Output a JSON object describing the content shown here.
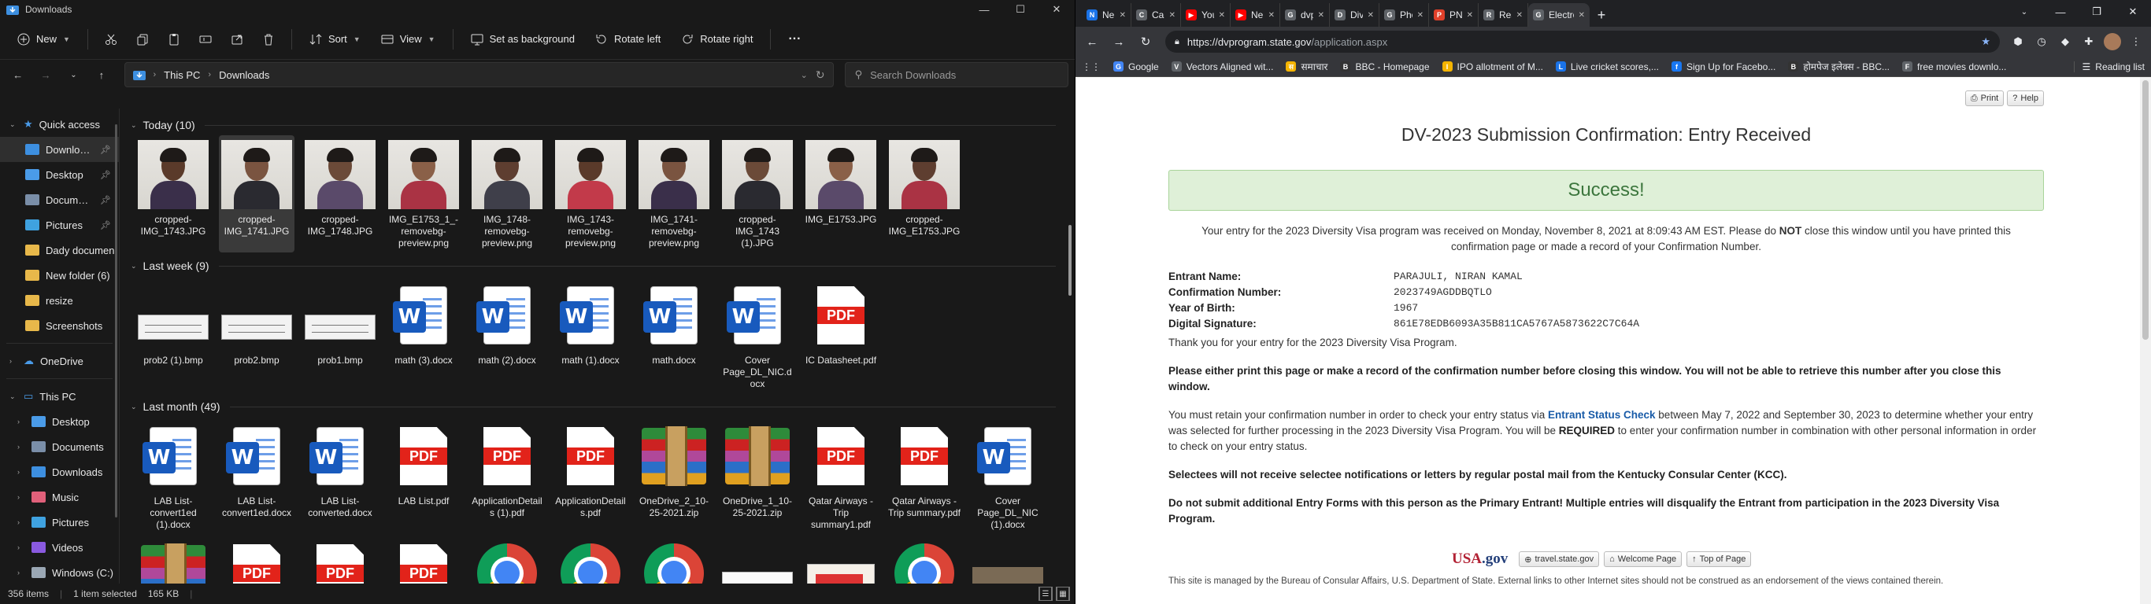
{
  "explorer": {
    "title": "Downloads",
    "window_controls": [
      "—",
      "☐",
      "✕"
    ],
    "commands": {
      "new": "New",
      "sort": "Sort",
      "view": "View",
      "set_background": "Set as background",
      "rotate_left": "Rotate left",
      "rotate_right": "Rotate right",
      "more": "···"
    },
    "breadcrumb": [
      "This PC",
      "Downloads"
    ],
    "search_placeholder": "Search Downloads",
    "nav": {
      "quick_access": "Quick access",
      "quick_items": [
        {
          "label": "Downloads",
          "pinned": true,
          "color": "#3d8fe0"
        },
        {
          "label": "Desktop",
          "pinned": true,
          "color": "#4a9be8"
        },
        {
          "label": "Documents",
          "pinned": true,
          "color": "#7a8ea8"
        },
        {
          "label": "Pictures",
          "pinned": true,
          "color": "#3fa2e0"
        },
        {
          "label": "Dady documen",
          "pinned": false,
          "color": "#e8b84a"
        },
        {
          "label": "New folder (6)",
          "pinned": false,
          "color": "#e8b84a"
        },
        {
          "label": "resize",
          "pinned": false,
          "color": "#e8b84a"
        },
        {
          "label": "Screenshots",
          "pinned": false,
          "color": "#e8b84a"
        }
      ],
      "onedrive": "OneDrive",
      "this_pc": "This PC",
      "pc_items": [
        {
          "label": "Desktop",
          "color": "#4a9be8"
        },
        {
          "label": "Documents",
          "color": "#7a8ea8"
        },
        {
          "label": "Downloads",
          "color": "#3d8fe0"
        },
        {
          "label": "Music",
          "color": "#e0607a"
        },
        {
          "label": "Pictures",
          "color": "#3fa2e0"
        },
        {
          "label": "Videos",
          "color": "#8a5ae0"
        },
        {
          "label": "Windows (C:)",
          "color": "#9aa7b4"
        }
      ]
    },
    "groups": {
      "today": {
        "label": "Today (10)",
        "files": [
          {
            "name": "cropped-IMG_1743.JPG",
            "type": "photo",
            "selected": false
          },
          {
            "name": "cropped-IMG_1741.JPG",
            "type": "photo",
            "selected": true
          },
          {
            "name": "cropped-IMG_1748.JPG",
            "type": "photo",
            "selected": false
          },
          {
            "name": "IMG_E1753_1_-removebg-preview.png",
            "type": "photo",
            "selected": false
          },
          {
            "name": "IMG_1748-removebg-preview.png",
            "type": "photo",
            "selected": false
          },
          {
            "name": "IMG_1743-removebg-preview.png",
            "type": "photo",
            "selected": false
          },
          {
            "name": "IMG_1741-removebg-preview.png",
            "type": "photo",
            "selected": false
          },
          {
            "name": "cropped-IMG_1743 (1).JPG",
            "type": "photo",
            "selected": false
          },
          {
            "name": "IMG_E1753.JPG",
            "type": "photo",
            "selected": false
          },
          {
            "name": "cropped-IMG_E1753.JPG",
            "type": "photo",
            "selected": false
          }
        ]
      },
      "last_week": {
        "label": "Last week (9)",
        "files": [
          {
            "name": "prob2 (1).bmp",
            "type": "bmp"
          },
          {
            "name": "prob2.bmp",
            "type": "bmp"
          },
          {
            "name": "prob1.bmp",
            "type": "bmp"
          },
          {
            "name": "math (3).docx",
            "type": "word"
          },
          {
            "name": "math (2).docx",
            "type": "word"
          },
          {
            "name": "math (1).docx",
            "type": "word"
          },
          {
            "name": "math.docx",
            "type": "word"
          },
          {
            "name": "Cover Page_DL_NIC.docx",
            "type": "word"
          },
          {
            "name": "IC Datasheet.pdf",
            "type": "pdf"
          }
        ]
      },
      "last_month": {
        "label": "Last month (49)",
        "files": [
          {
            "name": "LAB List-convert1ed (1).docx",
            "type": "word"
          },
          {
            "name": "LAB List-convert1ed.docx",
            "type": "word"
          },
          {
            "name": "LAB List-converted.docx",
            "type": "word"
          },
          {
            "name": "LAB List.pdf",
            "type": "pdf"
          },
          {
            "name": "ApplicationDetails (1).pdf",
            "type": "pdf"
          },
          {
            "name": "ApplicationDetails.pdf",
            "type": "pdf"
          },
          {
            "name": "OneDrive_2_10-25-2021.zip",
            "type": "zip"
          },
          {
            "name": "OneDrive_1_10-25-2021.zip",
            "type": "zip"
          },
          {
            "name": "Qatar Airways - Trip summary1.pdf",
            "type": "pdf"
          },
          {
            "name": "Qatar Airways - Trip summary.pdf",
            "type": "pdf"
          },
          {
            "name": "Cover Page_DL_NIC (1).docx",
            "type": "word"
          }
        ],
        "partial_row": [
          {
            "type": "zip"
          },
          {
            "type": "pdf"
          },
          {
            "type": "pdf"
          },
          {
            "type": "pdf"
          },
          {
            "type": "chrome"
          },
          {
            "type": "chrome"
          },
          {
            "type": "chrome"
          },
          {
            "type": "plain"
          },
          {
            "type": "news"
          },
          {
            "type": "chrome"
          },
          {
            "type": "group"
          }
        ]
      }
    },
    "status": {
      "count": "356 items",
      "selected": "1 item selected",
      "size": "165 KB"
    }
  },
  "browser": {
    "tabs": [
      {
        "title": "Nepse C",
        "color": "#1a73e8",
        "glyph": "N"
      },
      {
        "title": "Calculat",
        "color": "#5f6368",
        "glyph": "C"
      },
      {
        "title": "YouTube",
        "color": "#ff0000",
        "glyph": "▶"
      },
      {
        "title": "Nepal In",
        "color": "#ff0000",
        "glyph": "▶"
      },
      {
        "title": "dvprogr",
        "color": "#5f6368",
        "glyph": "G"
      },
      {
        "title": "Diversit",
        "color": "#5f6368",
        "glyph": "D"
      },
      {
        "title": "Photo-t",
        "color": "#5f6368",
        "glyph": "G"
      },
      {
        "title": "PNG to",
        "color": "#e0402a",
        "glyph": "P"
      },
      {
        "title": "Resize a",
        "color": "#5f6368",
        "glyph": "R"
      },
      {
        "title": "Electron",
        "color": "#5f6368",
        "glyph": "G",
        "active": true
      }
    ],
    "url_domain": "https://dvprogram.state.gov",
    "url_path": "/application.aspx",
    "bookmarks": [
      {
        "label": "Google",
        "color": "#4285f4",
        "glyph": "G"
      },
      {
        "label": "Vectors Aligned wit...",
        "color": "#5f6368",
        "glyph": "V"
      },
      {
        "label": "समाचार",
        "color": "#f4b400",
        "glyph": "स"
      },
      {
        "label": "BBC - Homepage",
        "color": "#333333",
        "glyph": "B"
      },
      {
        "label": "IPO allotment of M...",
        "color": "#f4b400",
        "glyph": "I"
      },
      {
        "label": "Live cricket scores,...",
        "color": "#1a73e8",
        "glyph": "L"
      },
      {
        "label": "Sign Up for Facebo...",
        "color": "#1877f2",
        "glyph": "f"
      },
      {
        "label": "होमपेज इलेक्स - BBC...",
        "color": "#333333",
        "glyph": "B"
      },
      {
        "label": "free movies downlo...",
        "color": "#5f6368",
        "glyph": "F"
      }
    ],
    "reading_list": "Reading list",
    "page": {
      "print": "Print",
      "help": "Help",
      "title": "DV-2023 Submission Confirmation: Entry Received",
      "success": "Success!",
      "intro_1": "Your entry for the 2023 Diversity Visa program was received on Monday, November 8, 2021 at 8:09:43 AM EST. Please do",
      "intro_not": "NOT",
      "intro_2": "close this window until you have printed this confirmation page or made a record of your Confirmation Number.",
      "entrant": [
        {
          "k": "Entrant Name:",
          "v": "PARAJULI, NIRAN KAMAL"
        },
        {
          "k": "Confirmation Number:",
          "v": "2023749AGDDBQTLO"
        },
        {
          "k": "Year of Birth:",
          "v": "1967"
        },
        {
          "k": "Digital Signature:",
          "v": "861E78EDB6093A35B811CA5767A5873622C7C64A"
        }
      ],
      "thanks": "Thank you for your entry for the 2023 Diversity Visa Program.",
      "please_print": "Please either print this page or make a record of the confirmation number before closing this window. You will not be able to retrieve this number after you close this window.",
      "retain_1": "You must retain your confirmation number in order to check your entry status via",
      "retain_link": "Entrant Status Check",
      "retain_2": "between May 7, 2022 and September 30, 2023 to determine whether your entry was selected for further processing in the 2023 Diversity Visa Program. You will be",
      "retain_req": "REQUIRED",
      "retain_3": "to enter your confirmation number in combination with other personal information in order to check on your entry status.",
      "selectees": "Selectees will not receive selectee notifications or letters by regular postal mail from the Kentucky Consular Center (KCC).",
      "do_not": "Do not submit additional Entry Forms with this person as the Primary Entrant! Multiple entries will disqualify the Entrant from participation in the 2023 Diversity Visa Program.",
      "usagov_a": "USA",
      "usagov_b": ".gov",
      "link_travel": "travel.state.gov",
      "link_welcome": "Welcome Page",
      "link_top": "Top of Page",
      "footer": "This site is managed by the Bureau of Consular Affairs, U.S. Department of State. External links to other Internet sites should not be construed as an endorsement of the views contained therein."
    }
  }
}
